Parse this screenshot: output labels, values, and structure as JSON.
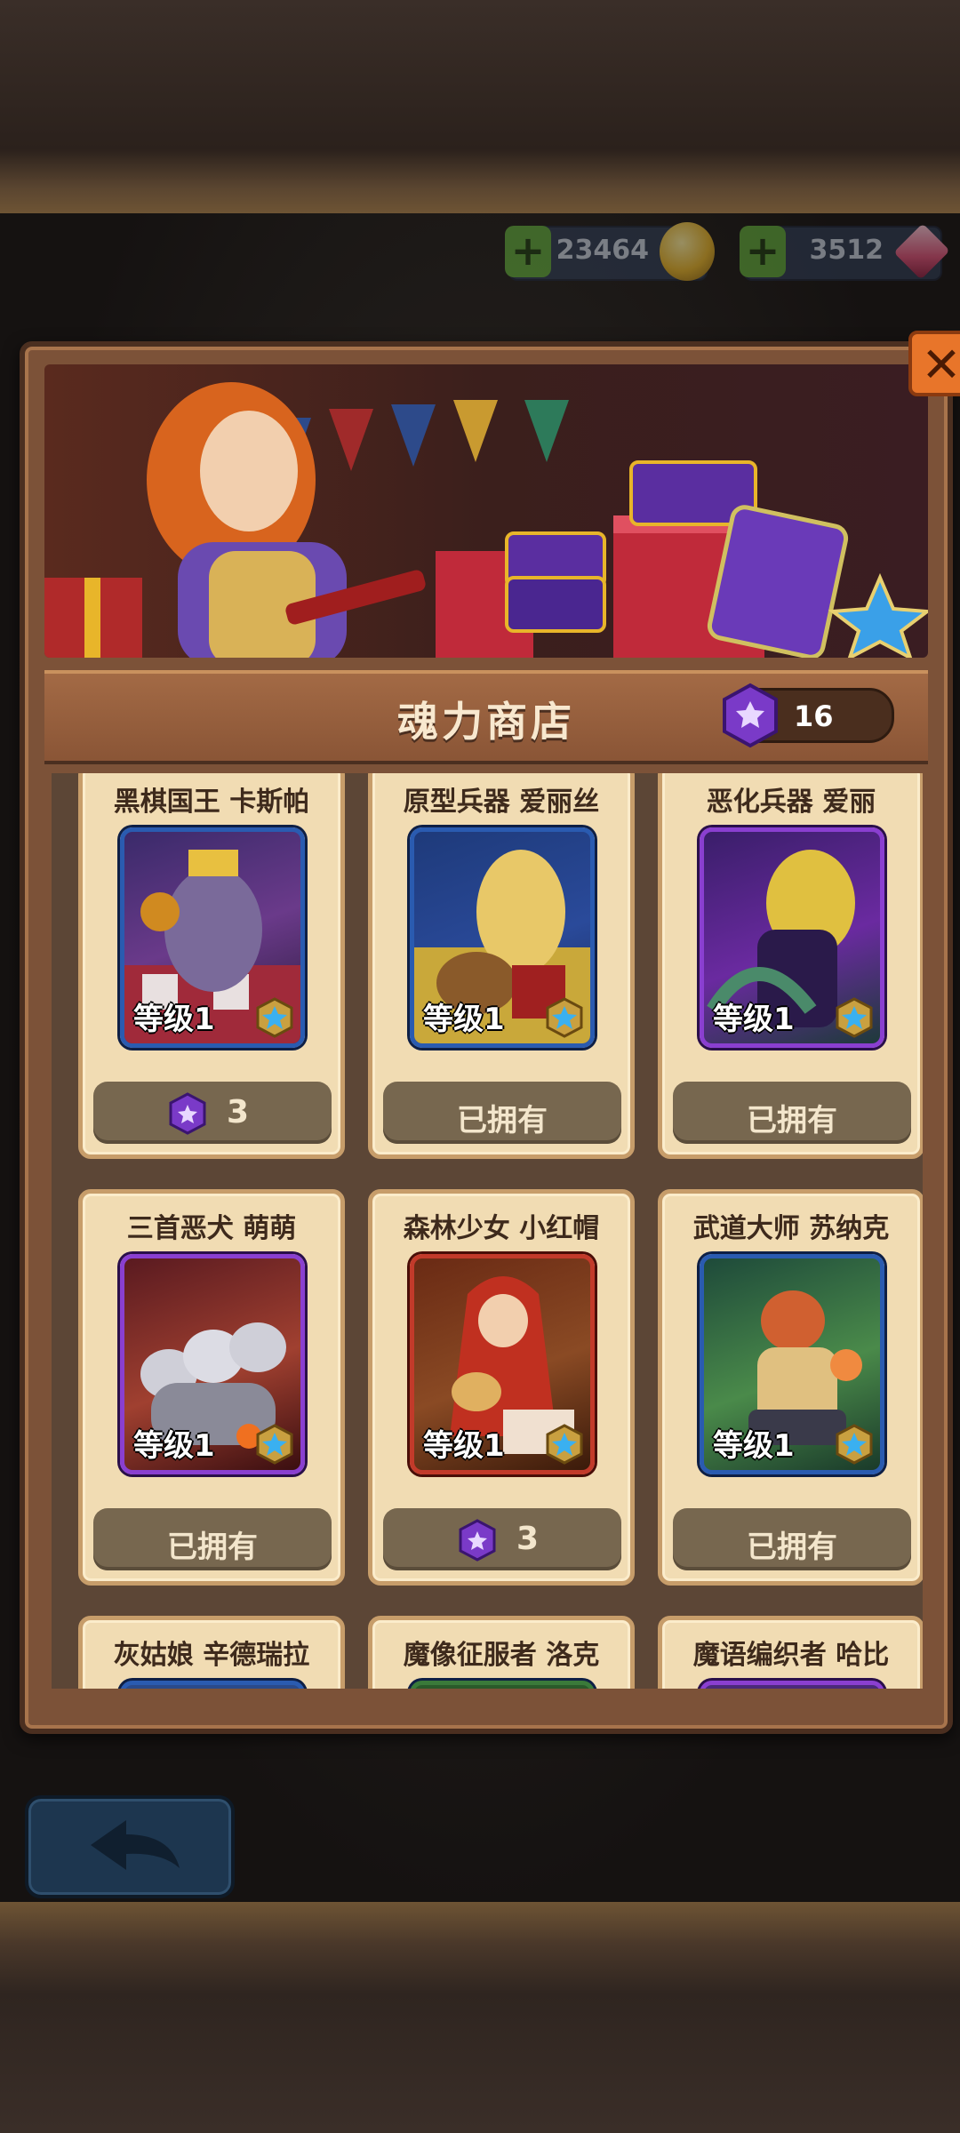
{
  "currencies": [
    {
      "name": "gold",
      "value": "23464",
      "icon": "coin-icon",
      "color": "#e8b52a"
    },
    {
      "name": "gems",
      "value": "3512",
      "icon": "gem-icon",
      "color": "#e0537a"
    }
  ],
  "shop": {
    "title": "魂力商店",
    "soul_gem_count": "16",
    "close_icon": "close-icon"
  },
  "cards": [
    {
      "name": "黑棋国王 卡斯帕",
      "level": "等级1",
      "frame": "blue",
      "status": "price",
      "price": "3",
      "owned_label": "",
      "art": [
        "#3a2a6a",
        "#6a3a8a",
        "#c9b04a"
      ]
    },
    {
      "name": "原型兵器 爱丽丝",
      "level": "等级1",
      "frame": "blue",
      "status": "owned",
      "price": "",
      "owned_label": "已拥有",
      "art": [
        "#1e3a7a",
        "#c9a83a",
        "#a02020"
      ]
    },
    {
      "name": "恶化兵器 爱丽",
      "level": "等级1",
      "frame": "purple",
      "status": "owned",
      "price": "",
      "owned_label": "已拥有",
      "art": [
        "#3a1e6a",
        "#6a2aa0",
        "#e0c040"
      ]
    },
    {
      "name": "三首恶犬 萌萌",
      "level": "等级1",
      "frame": "purple",
      "status": "owned",
      "price": "",
      "owned_label": "已拥有",
      "art": [
        "#5a1a20",
        "#a04030",
        "#cfcfd8"
      ]
    },
    {
      "name": "森林少女 小红帽",
      "level": "等级1",
      "frame": "red",
      "status": "price",
      "price": "3",
      "owned_label": "",
      "art": [
        "#6a2a14",
        "#c03020",
        "#e0b060"
      ]
    },
    {
      "name": "武道大师 苏纳克",
      "level": "等级1",
      "frame": "blue",
      "status": "owned",
      "price": "",
      "owned_label": "已拥有",
      "art": [
        "#1e4a3a",
        "#4a8a4a",
        "#d06030"
      ]
    },
    {
      "name": "灰姑娘 辛德瑞拉",
      "level": "",
      "frame": "blue",
      "status": "",
      "price": "",
      "owned_label": "",
      "art": [
        "#2a4a8a",
        "#2a4a8a",
        "#2a4a8a"
      ]
    },
    {
      "name": "魔像征服者 洛克",
      "level": "",
      "frame": "blue",
      "status": "",
      "price": "",
      "owned_label": "",
      "art": [
        "#2a5a2a",
        "#2a5a2a",
        "#2a5a2a"
      ]
    },
    {
      "name": "魔语编织者 哈比",
      "level": "",
      "frame": "purple",
      "status": "",
      "price": "",
      "owned_label": "",
      "art": [
        "#4a2a7a",
        "#4a2a7a",
        "#4a2a7a"
      ]
    }
  ],
  "footer": {
    "back_icon": "back-arrow-icon"
  }
}
